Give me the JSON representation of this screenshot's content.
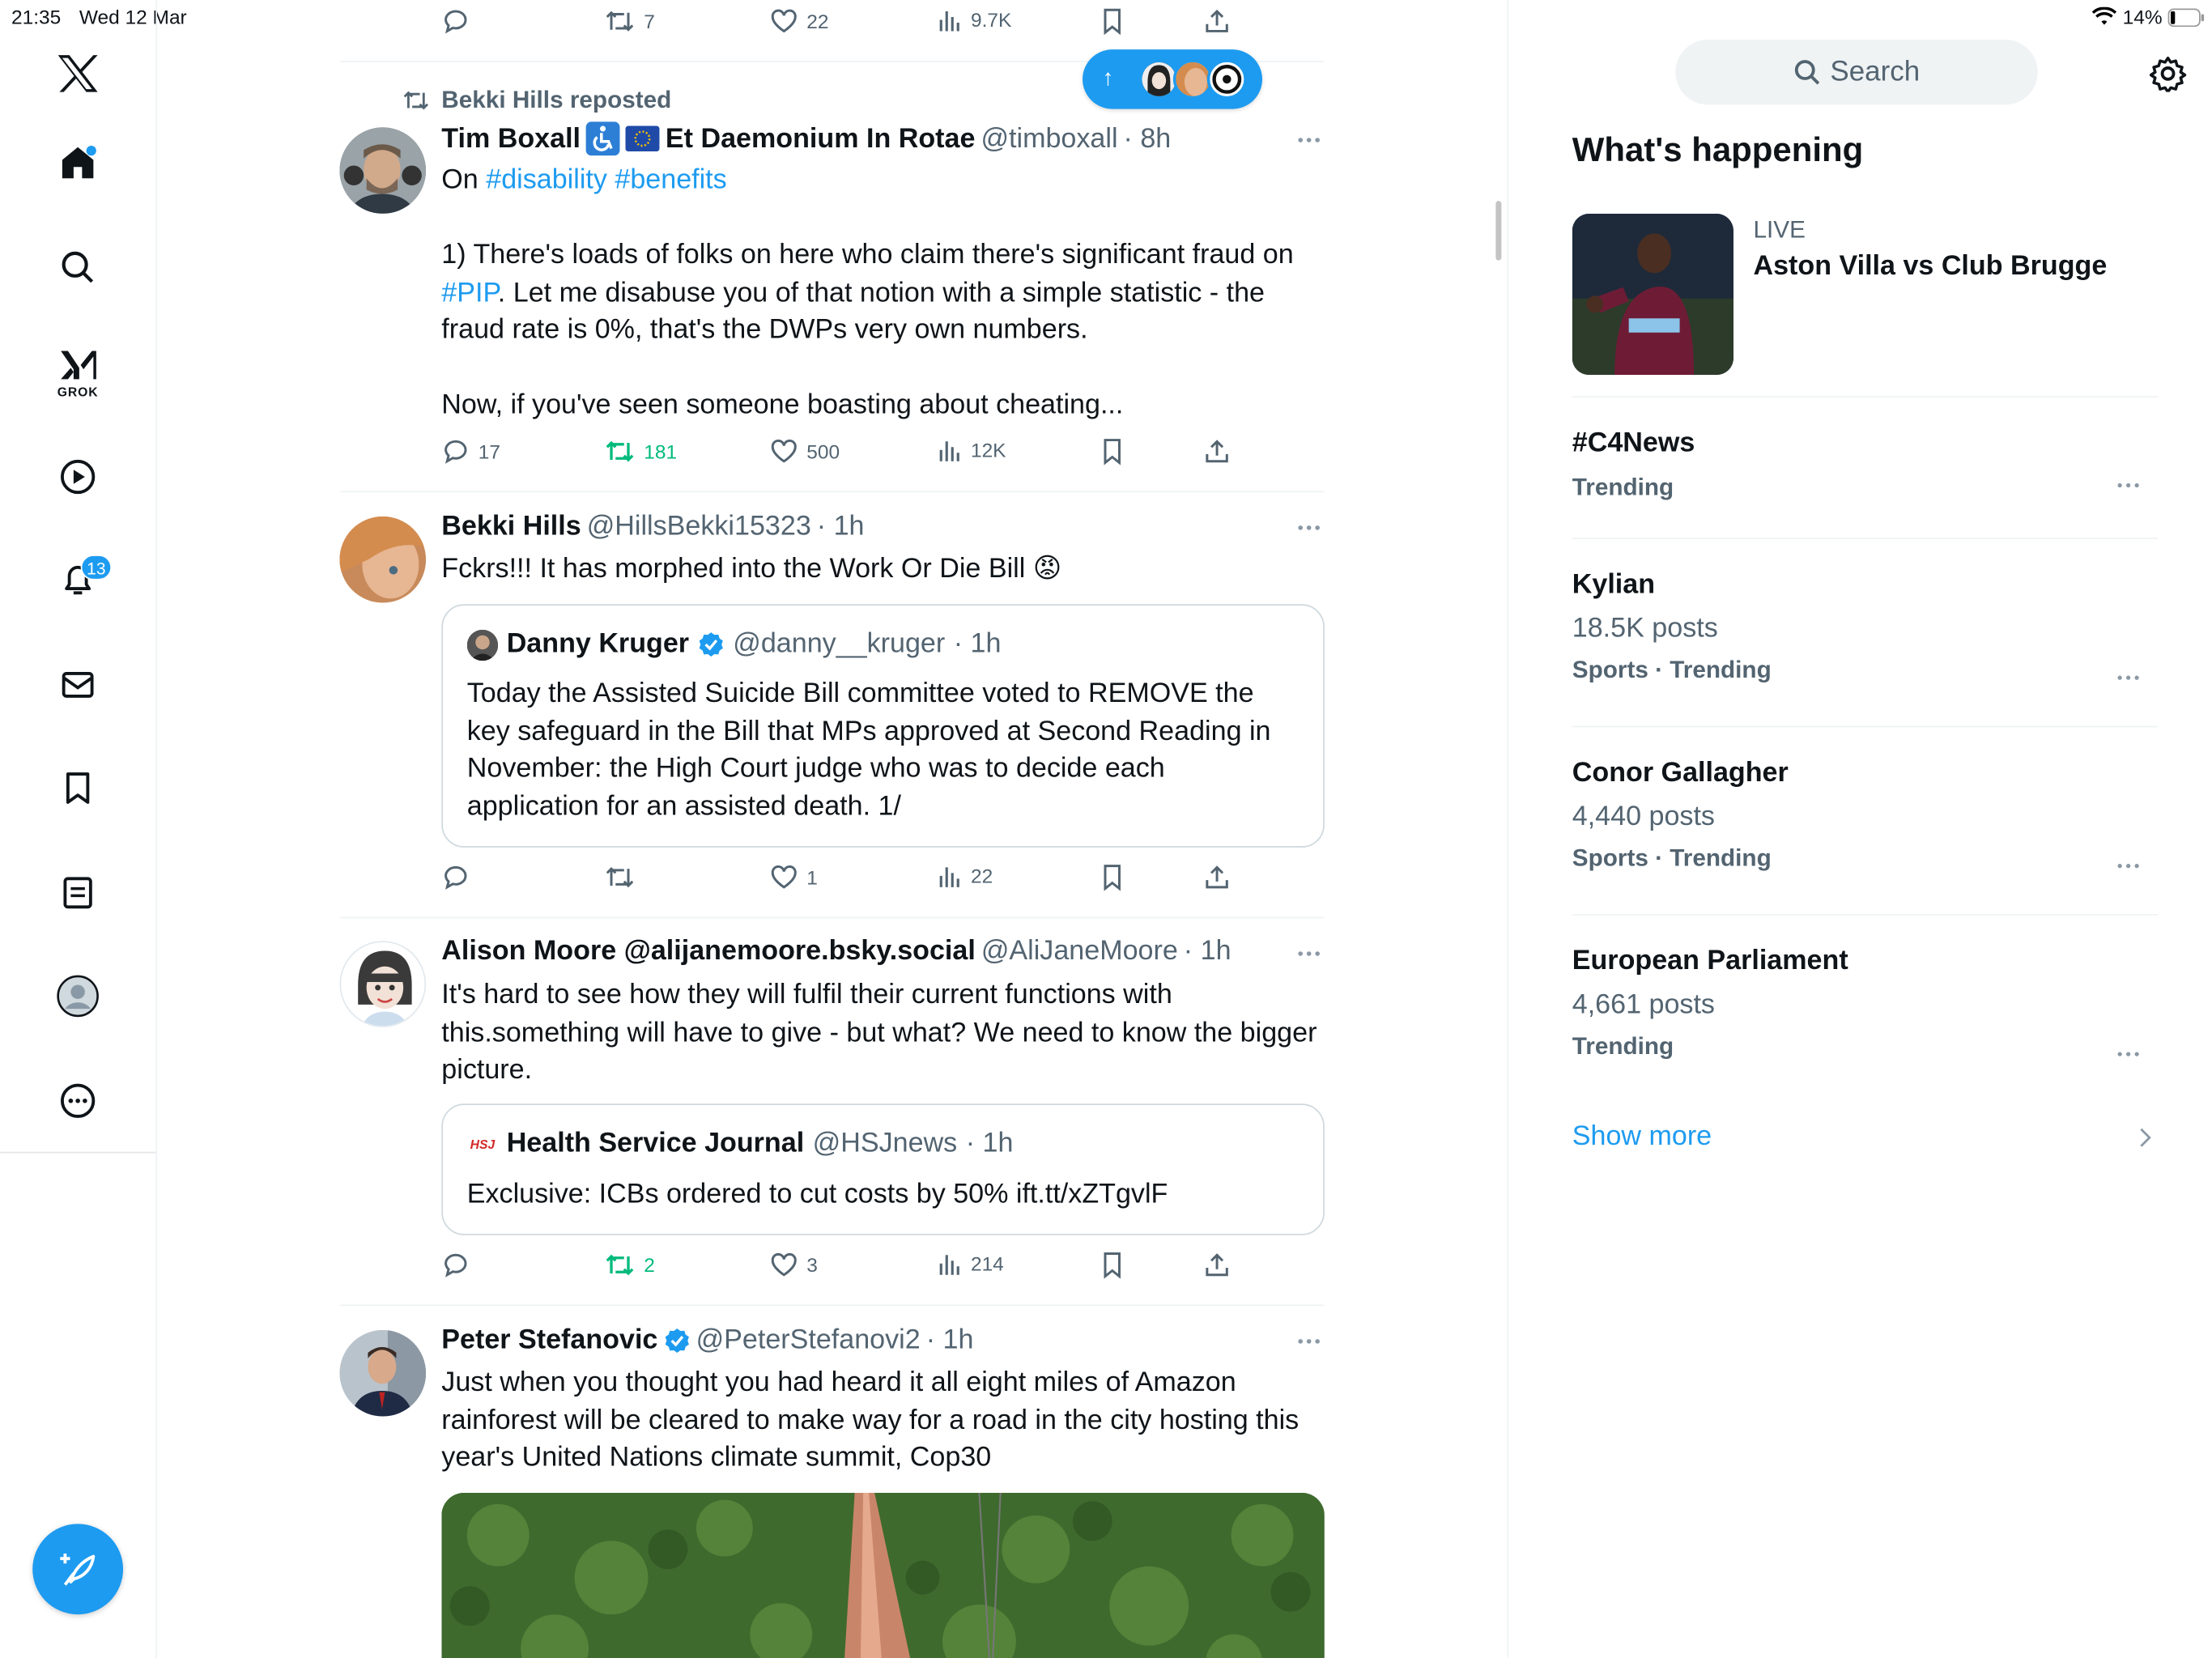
{
  "status_bar": {
    "time": "21:35",
    "date": "Wed 12 Mar",
    "battery": "14%"
  },
  "nav": {
    "grok_label": "GROK",
    "notifications_count": "13"
  },
  "new_posts": {
    "arrow": "↑"
  },
  "top_actions": {
    "replies": "",
    "reposts": "7",
    "likes": "22",
    "views": "9.7K"
  },
  "posts": [
    {
      "repost_note": "Bekki Hills reposted",
      "name": "Tim Boxall",
      "extra_name": "Et Daemonium In Rotae",
      "handle": "@timboxall",
      "time": "· 8h",
      "line1_pre": "On ",
      "hashtags": "#disability #benefits",
      "para1": "1) There's loads of folks on here who claim there's significant fraud on",
      "para1_link": "#PIP",
      "para1_rest": ". Let me disabuse you of that notion with a simple statistic - the fraud rate is 0%, that's the DWPs very own numbers.",
      "para2": "Now, if you've seen someone boasting about cheating...",
      "replies": "17",
      "reposts": "181",
      "likes": "500",
      "views": "12K"
    },
    {
      "name": "Bekki Hills",
      "handle": "@HillsBekki15323",
      "time": "· 1h",
      "text": "Fckrs!!! It has morphed into the Work Or Die Bill 😡",
      "quote": {
        "name": "Danny Kruger",
        "handle": "@danny__kruger",
        "time": "· 1h",
        "text": "Today the Assisted Suicide Bill committee voted to REMOVE the key safeguard in the Bill that MPs approved at Second Reading in November: the High Court judge who was to decide each application for an assisted death. 1/"
      },
      "replies": "",
      "reposts": "",
      "likes": "1",
      "views": "22"
    },
    {
      "name": "Alison Moore @alijanemoore.bsky.social",
      "handle": "@AliJaneMoore",
      "time": "· 1h",
      "text": "It's hard to see how they will fulfil their current functions with this.something will have to give - but what? We need to know the bigger picture.",
      "quote": {
        "logo": "HSJ",
        "name": "Health Service Journal",
        "handle": "@HSJnews",
        "time": "· 1h",
        "text": "Exclusive: ICBs ordered to cut costs by 50% ift.tt/xZTgvlF"
      },
      "replies": "",
      "reposts": "2",
      "likes": "3",
      "views": "214"
    },
    {
      "name": "Peter Stefanovic",
      "handle": "@PeterStefanovi2",
      "time": "· 1h",
      "text": "Just when you thought you had heard it all eight miles of Amazon rainforest will be cleared to make way for a road in the city hosting this year's United Nations climate summit, Cop30"
    }
  ],
  "sidebar": {
    "search_placeholder": "Search",
    "heading": "What's happening",
    "live": {
      "label": "LIVE",
      "title": "Aston Villa vs Club Brugge"
    },
    "trends": [
      {
        "title": "#C4News",
        "posts": "",
        "meta": "Trending"
      },
      {
        "title": "Kylian",
        "posts": "18.5K posts",
        "meta": "Sports · Trending"
      },
      {
        "title": "Conor Gallagher",
        "posts": "4,440 posts",
        "meta": "Sports · Trending"
      },
      {
        "title": "European Parliament",
        "posts": "4,661 posts",
        "meta": "Trending"
      }
    ],
    "show_more": "Show more"
  },
  "colors": {
    "accent": "#1d9bf0",
    "repost_green": "#00ba7c",
    "muted": "#536471"
  }
}
